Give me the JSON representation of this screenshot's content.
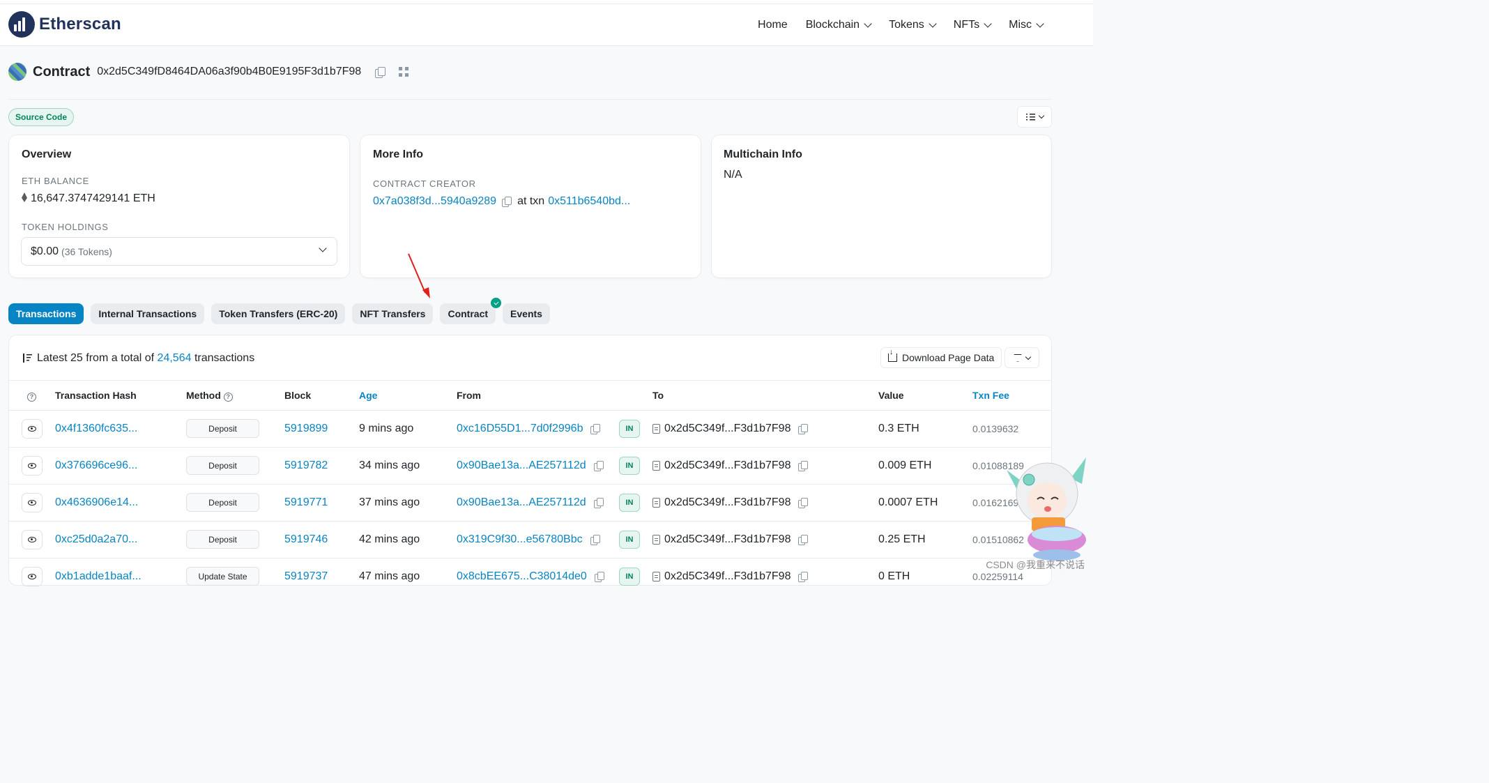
{
  "brand": {
    "name": "Etherscan"
  },
  "nav": [
    {
      "label": "Home",
      "dropdown": false
    },
    {
      "label": "Blockchain",
      "dropdown": true
    },
    {
      "label": "Tokens",
      "dropdown": true
    },
    {
      "label": "NFTs",
      "dropdown": true
    },
    {
      "label": "Misc",
      "dropdown": true
    }
  ],
  "page": {
    "type_label": "Contract",
    "address": "0x2d5C349fD8464DA06a3f90b4B0E9195F3d1b7F98",
    "source_badge": "Source Code"
  },
  "overview": {
    "title": "Overview",
    "eth_balance_label": "ETH BALANCE",
    "eth_balance": "16,647.3747429141 ETH",
    "token_holdings_label": "TOKEN HOLDINGS",
    "token_value": "$0.00",
    "token_count": "(36 Tokens)"
  },
  "more_info": {
    "title": "More Info",
    "creator_label": "CONTRACT CREATOR",
    "creator": "0x7a038f3d...5940a9289",
    "at_txn": "at txn",
    "txn": "0x511b6540bd..."
  },
  "multichain": {
    "title": "Multichain Info",
    "value": "N/A"
  },
  "tabs": [
    {
      "label": "Transactions",
      "active": true,
      "verified": false
    },
    {
      "label": "Internal Transactions",
      "active": false,
      "verified": false
    },
    {
      "label": "Token Transfers (ERC-20)",
      "active": false,
      "verified": false
    },
    {
      "label": "NFT Transfers",
      "active": false,
      "verified": false
    },
    {
      "label": "Contract",
      "active": false,
      "verified": true
    },
    {
      "label": "Events",
      "active": false,
      "verified": false
    }
  ],
  "txns": {
    "summary_prefix": "Latest 25 from a total of",
    "summary_count": "24,564",
    "summary_suffix": "transactions",
    "download_label": "Download Page Data",
    "columns": {
      "hash": "Transaction Hash",
      "method": "Method",
      "block": "Block",
      "age": "Age",
      "from": "From",
      "to": "To",
      "value": "Value",
      "fee": "Txn Fee"
    },
    "rows": [
      {
        "hash": "0x4f1360fc635...",
        "method": "Deposit",
        "block": "5919899",
        "age": "9 mins ago",
        "from": "0xc16D55D1...7d0f2996b",
        "dir": "IN",
        "to": "0x2d5C349f...F3d1b7F98",
        "value": "0.3 ETH",
        "fee": "0.0139632"
      },
      {
        "hash": "0x376696ce96...",
        "method": "Deposit",
        "block": "5919782",
        "age": "34 mins ago",
        "from": "0x90Bae13a...AE257112d",
        "dir": "IN",
        "to": "0x2d5C349f...F3d1b7F98",
        "value": "0.009 ETH",
        "fee": "0.01088189"
      },
      {
        "hash": "0x4636906e14...",
        "method": "Deposit",
        "block": "5919771",
        "age": "37 mins ago",
        "from": "0x90Bae13a...AE257112d",
        "dir": "IN",
        "to": "0x2d5C349f...F3d1b7F98",
        "value": "0.0007 ETH",
        "fee": "0.01621694"
      },
      {
        "hash": "0xc25d0a2a70...",
        "method": "Deposit",
        "block": "5919746",
        "age": "42 mins ago",
        "from": "0x319C9f30...e56780Bbc",
        "dir": "IN",
        "to": "0x2d5C349f...F3d1b7F98",
        "value": "0.25 ETH",
        "fee": "0.01510862"
      },
      {
        "hash": "0xb1adde1baaf...",
        "method": "Update State",
        "block": "5919737",
        "age": "47 mins ago",
        "from": "0x8cbEE675...C38014de0",
        "dir": "IN",
        "to": "0x2d5C349f...F3d1b7F98",
        "value": "0 ETH",
        "fee": "0.02259114"
      }
    ]
  },
  "watermark": "CSDN @我重来不说话",
  "colors": {
    "link": "#0784c3",
    "brand": "#21325b",
    "success": "#00a186",
    "annotation_arrow": "#e0201b"
  }
}
